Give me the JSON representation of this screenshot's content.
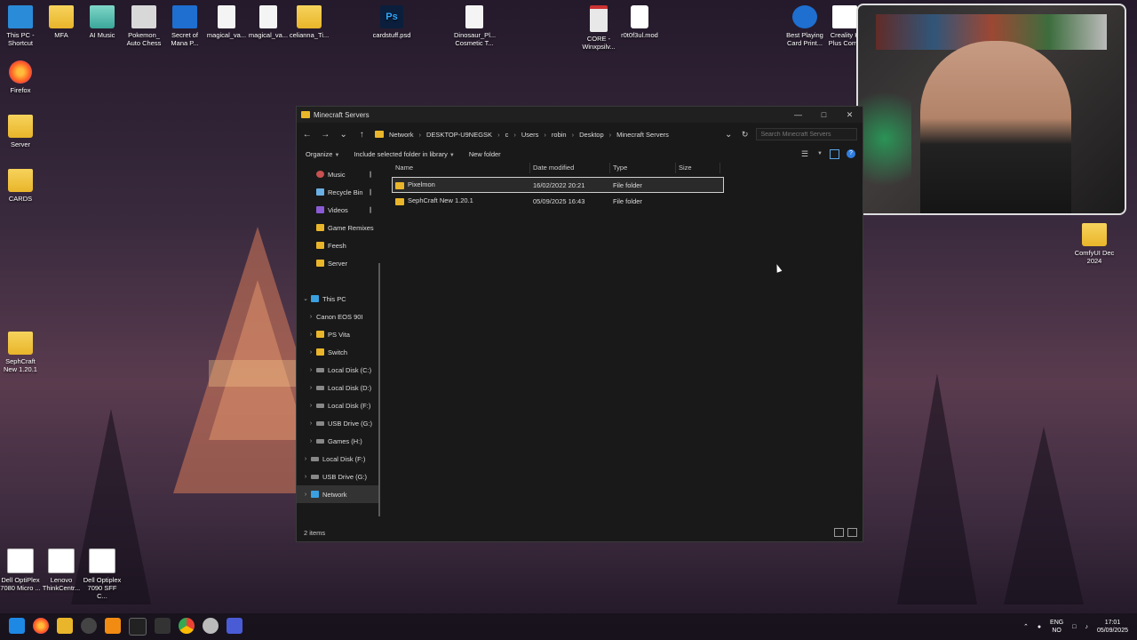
{
  "desktop": {
    "icons": [
      {
        "label": "This PC - Shortcut"
      },
      {
        "label": "MFA"
      },
      {
        "label": "AI Music"
      },
      {
        "label": "Pokemon_ Auto Chess"
      },
      {
        "label": "Secret of Mana P..."
      },
      {
        "label": "magical_va..."
      },
      {
        "label": "magical_va..."
      },
      {
        "label": "celianna_Ti..."
      },
      {
        "label": "cardstuff.psd"
      },
      {
        "label": "Dinosaur_Pl... Cosmetic T..."
      },
      {
        "label": "CORE - Winxpsilv..."
      },
      {
        "label": "r0t0f3ul.mod"
      },
      {
        "label": "Best Playing Card Print..."
      },
      {
        "label": "Creality K Plus Comb"
      },
      {
        "label": "Firefox"
      },
      {
        "label": "Server"
      },
      {
        "label": "CARDS"
      },
      {
        "label": "SephCraft New 1.20.1"
      },
      {
        "label": "ComfyUI Dec 2024"
      },
      {
        "label": "Dell OptiPlex 7080 Micro ..."
      },
      {
        "label": "Lenovo ThinkCentr..."
      },
      {
        "label": "Dell Optiplex 7090 SFF C..."
      }
    ]
  },
  "explorer": {
    "title": "Minecraft Servers",
    "breadcrumbs": [
      "Network",
      "DESKTOP-U9NEGSK",
      "c",
      "Users",
      "robin",
      "Desktop",
      "Minecraft Servers"
    ],
    "search_placeholder": "Search Minecraft Servers",
    "toolbar": {
      "organize": "Organize",
      "include": "Include selected folder in library",
      "new_folder": "New folder"
    },
    "nav": [
      {
        "label": "Music",
        "icon": "music-icon",
        "pinned": true
      },
      {
        "label": "Recycle Bin",
        "icon": "recycle-bin-icon",
        "pinned": true
      },
      {
        "label": "Videos",
        "icon": "videos-icon",
        "pinned": true
      },
      {
        "label": "Game Remixes",
        "icon": "folder-icon"
      },
      {
        "label": "Feesh",
        "icon": "folder-icon"
      },
      {
        "label": "Server",
        "icon": "folder-icon"
      },
      {
        "label": "This PC",
        "icon": "pc-icon"
      },
      {
        "label": "Canon EOS 90I",
        "icon": "camera-icon"
      },
      {
        "label": "PS Vita",
        "icon": "folder-icon"
      },
      {
        "label": "Switch",
        "icon": "folder-icon"
      },
      {
        "label": "Local Disk (C:)",
        "icon": "drive-icon"
      },
      {
        "label": "Local Disk (D:)",
        "icon": "drive-icon"
      },
      {
        "label": "Local Disk (F:)",
        "icon": "drive-icon"
      },
      {
        "label": "USB Drive (G:)",
        "icon": "drive-icon"
      },
      {
        "label": "Games (H:)",
        "icon": "drive-icon"
      },
      {
        "label": "Local Disk (F:)",
        "icon": "drive-icon"
      },
      {
        "label": "USB Drive (G:)",
        "icon": "drive-icon"
      },
      {
        "label": "Network",
        "icon": "network-icon"
      }
    ],
    "columns": {
      "name": "Name",
      "date": "Date modified",
      "type": "Type",
      "size": "Size"
    },
    "files": [
      {
        "name": "Pixelmon",
        "date": "16/02/2022 20:21",
        "type": "File folder",
        "size": ""
      },
      {
        "name": "SephCraft New 1.20.1",
        "date": "05/09/2025 16:43",
        "type": "File folder",
        "size": ""
      }
    ],
    "status": "2 items"
  },
  "taskbar": {
    "lang_top": "ENG",
    "lang_bottom": "NO",
    "time": "17:01",
    "date": "05/09/2025"
  }
}
